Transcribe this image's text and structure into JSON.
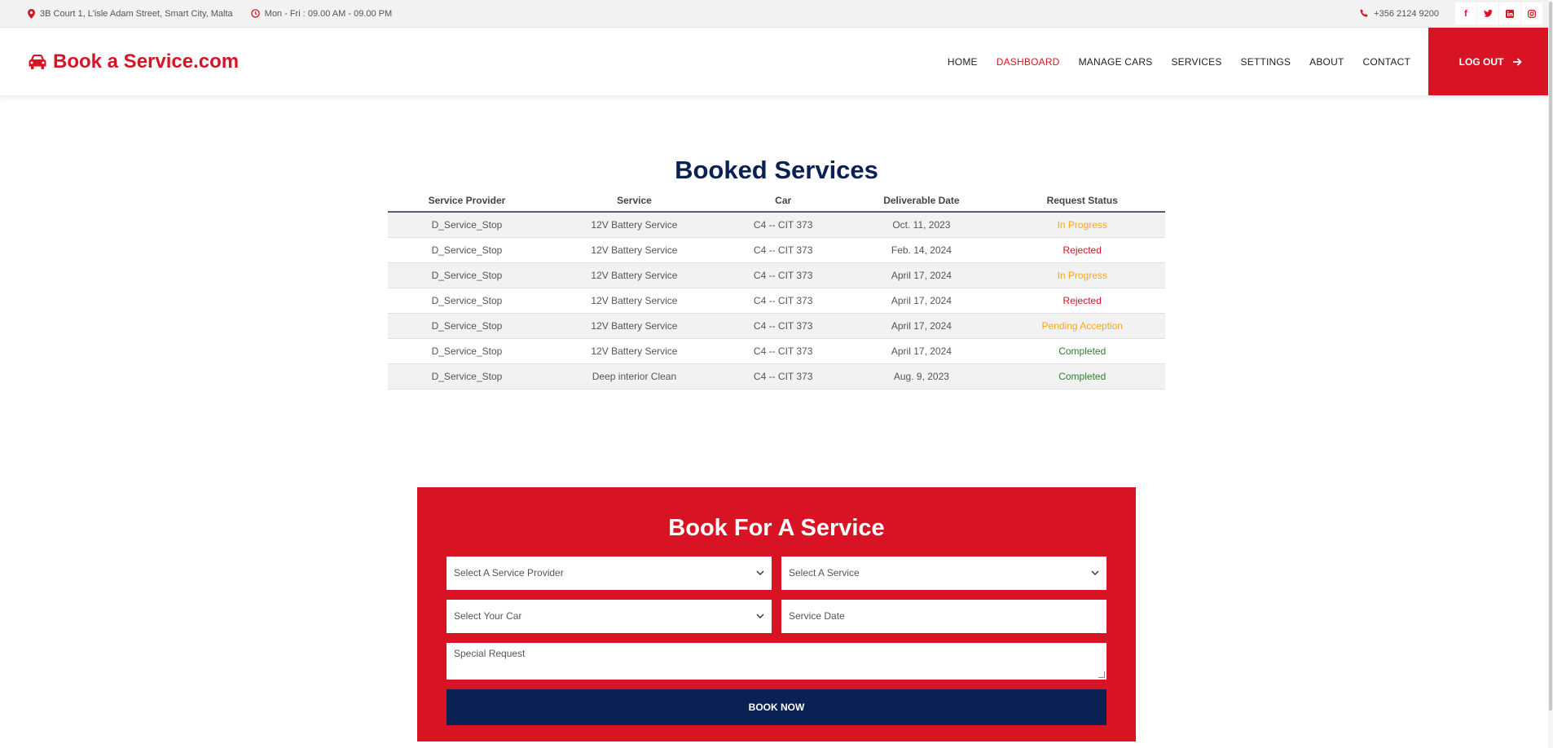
{
  "topbar": {
    "address": "3B Court 1, L'isle Adam Street, Smart City, Malta",
    "hours": "Mon - Fri : 09.00 AM - 09.00 PM",
    "phone": "+356 2124 9200",
    "social": [
      "facebook-icon",
      "twitter-icon",
      "linkedin-icon",
      "instagram-icon"
    ]
  },
  "nav": {
    "brand": "Book a Service.com",
    "links": [
      "HOME",
      "DASHBOARD",
      "MANAGE CARS",
      "SERVICES",
      "SETTINGS",
      "ABOUT",
      "CONTACT"
    ],
    "active": "DASHBOARD",
    "logout": "LOG OUT"
  },
  "booked": {
    "title": "Booked Services",
    "columns": [
      "Service Provider",
      "Service",
      "Car",
      "Deliverable Date",
      "Request Status"
    ],
    "rows": [
      [
        "D_Service_Stop",
        "12V Battery Service",
        "C4 -- CIT 373",
        "Oct. 11, 2023",
        "In Progress"
      ],
      [
        "D_Service_Stop",
        "12V Battery Service",
        "C4 -- CIT 373",
        "Feb. 14, 2024",
        "Rejected"
      ],
      [
        "D_Service_Stop",
        "12V Battery Service",
        "C4 -- CIT 373",
        "April 17, 2024",
        "In Progress"
      ],
      [
        "D_Service_Stop",
        "12V Battery Service",
        "C4 -- CIT 373",
        "April 17, 2024",
        "Rejected"
      ],
      [
        "D_Service_Stop",
        "12V Battery Service",
        "C4 -- CIT 373",
        "April 17, 2024",
        "Pending Acception"
      ],
      [
        "D_Service_Stop",
        "12V Battery Service",
        "C4 -- CIT 373",
        "April 17, 2024",
        "Completed"
      ],
      [
        "D_Service_Stop",
        "Deep interior Clean",
        "C4 -- CIT 373",
        "Aug. 9, 2023",
        "Completed"
      ]
    ],
    "status_colors": {
      "In Progress": "#f5a623",
      "Rejected": "#d81324",
      "Pending Acception": "#f5a623",
      "Completed": "#2e7d32"
    }
  },
  "book": {
    "title": "Book For A Service",
    "provider_placeholder": "Select A Service Provider",
    "service_placeholder": "Select A Service",
    "car_placeholder": "Select Your Car",
    "date_placeholder": "Service Date",
    "request_placeholder": "Special Request",
    "submit": "BOOK NOW"
  },
  "colors": {
    "brand": "#d81324",
    "navy": "#0b2154"
  }
}
